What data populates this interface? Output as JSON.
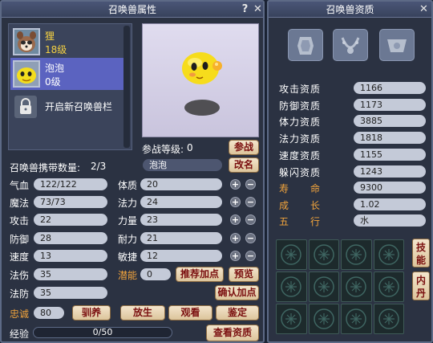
{
  "left_panel": {
    "title": "召唤兽属性",
    "help": "?",
    "close": "✕",
    "pets": [
      {
        "name": "狸",
        "level": "18级"
      },
      {
        "name": "泡泡",
        "level": "0级"
      }
    ],
    "unlock_label": "开启新召唤兽栏",
    "battle_level_label": "参战等级:",
    "battle_level_value": "0",
    "battle_button": "参战",
    "carry_label": "召唤兽携带数量:",
    "carry_value": "2/3",
    "name_value": "泡泡",
    "rename_button": "改名",
    "stats_left": [
      {
        "label": "气血",
        "value": "122/122"
      },
      {
        "label": "魔法",
        "value": "73/73"
      },
      {
        "label": "攻击",
        "value": "22"
      },
      {
        "label": "防御",
        "value": "28"
      },
      {
        "label": "速度",
        "value": "13"
      },
      {
        "label": "法伤",
        "value": "35"
      },
      {
        "label": "法防",
        "value": "35"
      }
    ],
    "stats_right": [
      {
        "label": "体质",
        "value": "20"
      },
      {
        "label": "法力",
        "value": "24"
      },
      {
        "label": "力量",
        "value": "23"
      },
      {
        "label": "耐力",
        "value": "21"
      },
      {
        "label": "敏捷",
        "value": "12"
      }
    ],
    "potential_label": "潜能",
    "potential_value": "0",
    "recommend_button": "推荐加点",
    "preview_button": "预览",
    "confirm_button": "确认加点",
    "loyalty_label": "忠诚",
    "loyalty_value": "80",
    "tame_button": "驯养",
    "release_button": "放生",
    "watch_button": "观看",
    "appraise_button": "鉴定",
    "exp_label": "经验",
    "exp_value": "0/50",
    "view_aptitude_button": "查看资质",
    "plus": "+",
    "minus": "−"
  },
  "right_panel": {
    "title": "召唤兽资质",
    "close": "✕",
    "aptitudes": [
      {
        "label": "攻击资质",
        "value": "1166"
      },
      {
        "label": "防御资质",
        "value": "1173"
      },
      {
        "label": "体力资质",
        "value": "3885"
      },
      {
        "label": "法力资质",
        "value": "1818"
      },
      {
        "label": "速度资质",
        "value": "1155"
      },
      {
        "label": "躲闪资质",
        "value": "1243"
      }
    ],
    "lifespan_label": "寿　　命",
    "lifespan_value": "9300",
    "growth_label": "成　　长",
    "growth_value": "1.02",
    "element_label": "五　　行",
    "element_value": "水",
    "skills_button": "技能",
    "inner_button": "内丹",
    "equip_icons": [
      "armor-icon",
      "necklace-icon",
      "collar-icon"
    ]
  },
  "colors": {
    "accent_orange": "#f2a43c",
    "button_text": "#7a0f0f",
    "selected_row": "#5b63c0"
  }
}
